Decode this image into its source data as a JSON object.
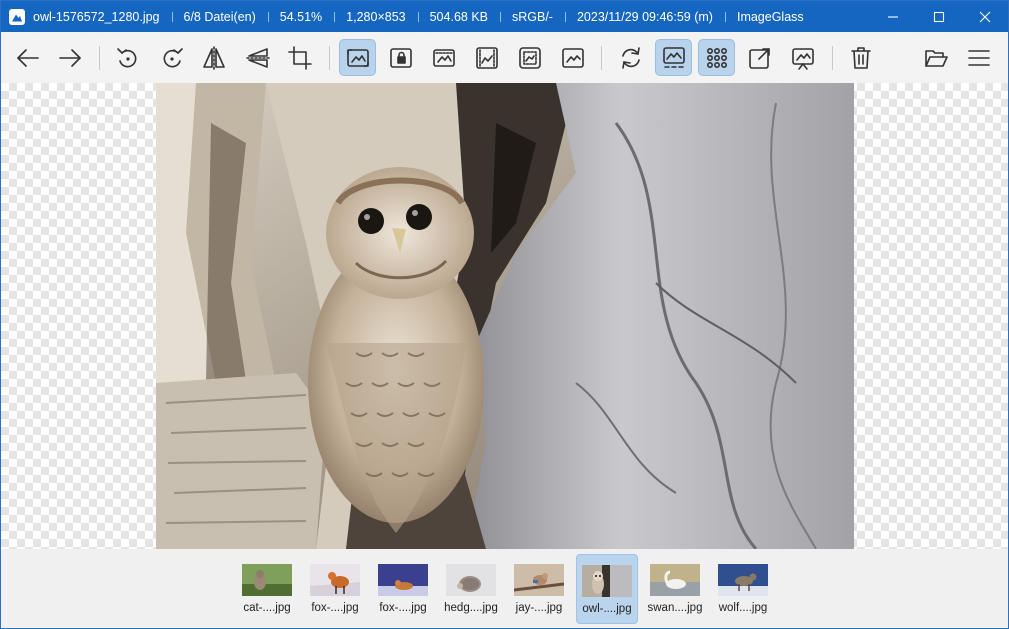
{
  "titlebar": {
    "filename": "owl-1576572_1280.jpg",
    "position": "6/8 Datei(en)",
    "zoom": "54.51%",
    "dimensions": "1,280×853",
    "filesize": "504.68 KB",
    "colorspace": "sRGB/-",
    "datetime": "2023/11/29 09:46:59 (m)",
    "app_name": "ImageGlass"
  },
  "toolbar": {
    "active_buttons": [
      "zoom-fit",
      "thumbnail-bar",
      "gallery",
      "view-fit"
    ]
  },
  "thumbnails": [
    {
      "label": "cat-....jpg",
      "active": false
    },
    {
      "label": "fox-....jpg",
      "active": false
    },
    {
      "label": "fox-....jpg",
      "active": false
    },
    {
      "label": "hedg....jpg",
      "active": false
    },
    {
      "label": "jay-....jpg",
      "active": false
    },
    {
      "label": "owl-....jpg",
      "active": true
    },
    {
      "label": "swan....jpg",
      "active": false
    },
    {
      "label": "wolf....jpg",
      "active": false
    }
  ],
  "colors": {
    "titlebar_bg": "#1566c0",
    "active_button_bg": "#b9d3ec",
    "checker": "#e4e4e4"
  }
}
